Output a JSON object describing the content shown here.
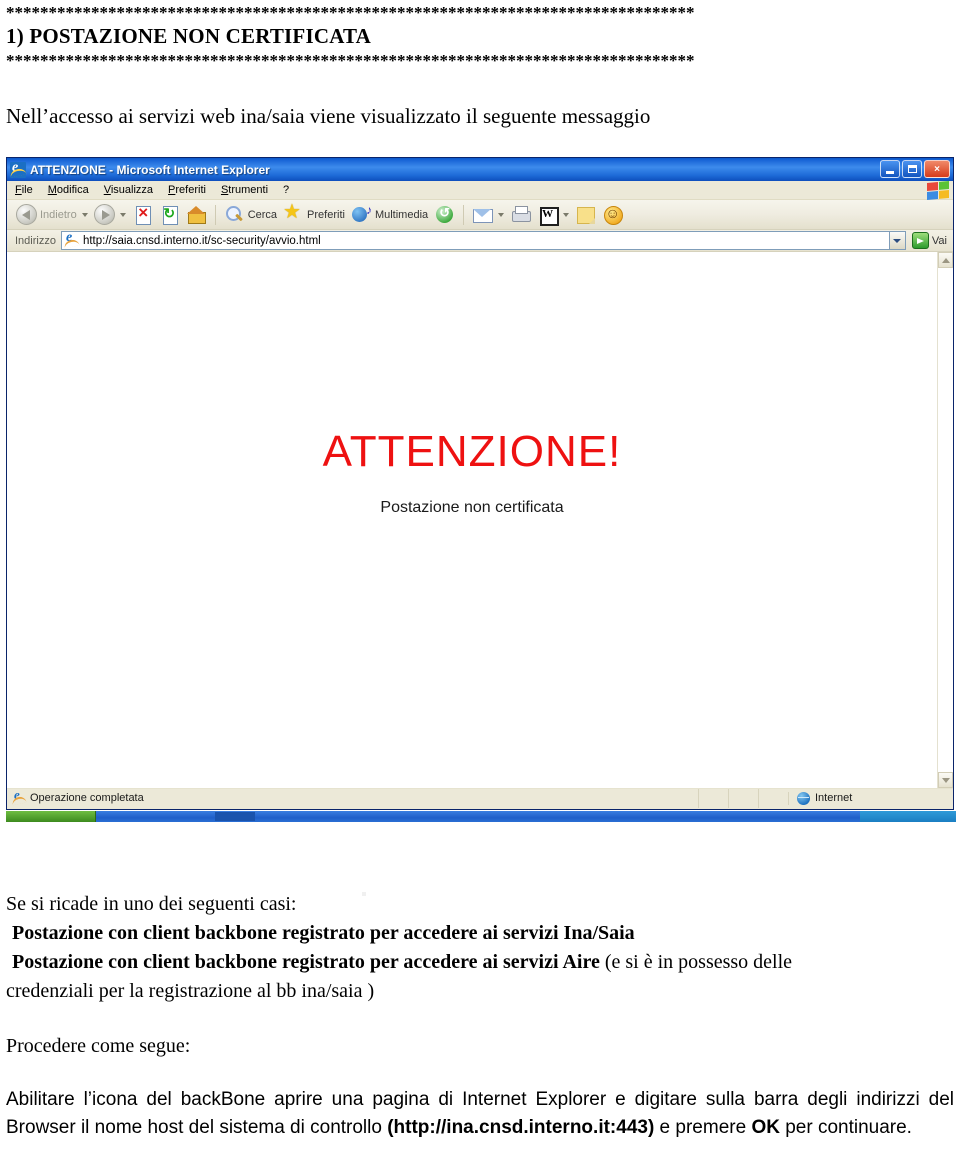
{
  "document": {
    "stars_top": "*********************************************************************************",
    "heading": "1) POSTAZIONE NON CERTIFICATA",
    "stars_bottom": "*********************************************************************************",
    "intro": "Nell’accesso ai servizi web ina/saia viene visualizzato il seguente messaggio",
    "cases_intro": "Se si ricade in uno dei seguenti casi:",
    "case_1": "Postazione con client backbone registrato per accedere ai servizi Ina/Saia",
    "case_2_bold": "Postazione con client backbone registrato per accedere ai servizi Aire",
    "case_2_rest": "(e si è in possesso delle",
    "case_2_cont": "credenziali per la registrazione al bb ina/saia )",
    "procedere": "Procedere come segue:",
    "final_part1": "Abilitare l’icona del backBone aprire una pagina di Internet Explorer e digitare sulla barra degli indirizzi del Browser il nome host del sistema di controllo ",
    "final_url": "(http://ina.cnsd.interno.it:443)",
    "final_part2": " e premere ",
    "final_ok": "OK",
    "final_part3": " per continuare."
  },
  "browser": {
    "titlebar": {
      "title": "ATTENZIONE - Microsoft Internet Explorer",
      "icon": "ie-logo-icon",
      "minimize_label": "",
      "restore_label": "",
      "close_label": "×"
    },
    "menu": [
      {
        "label": "File",
        "accel": "F"
      },
      {
        "label": "Modifica",
        "accel": "M"
      },
      {
        "label": "Visualizza",
        "accel": "V"
      },
      {
        "label": "Preferiti",
        "accel": "P"
      },
      {
        "label": "Strumenti",
        "accel": "S"
      },
      {
        "label": "?",
        "accel": ""
      }
    ],
    "toolbar": {
      "back_label": "Indietro",
      "forward_label": "",
      "stop_label": "",
      "refresh_label": "",
      "home_label": "",
      "search_label": "Cerca",
      "favorites_label": "Preferiti",
      "multimedia_label": "Multimedia",
      "history_label": "",
      "mail_label": "",
      "print_label": "",
      "edit_label": "",
      "note_label": "",
      "smiley_label": ""
    },
    "address": {
      "label": "Indirizzo",
      "url": "http://saia.cnsd.interno.it/sc-security/avvio.html",
      "go_label": "Vai"
    },
    "page": {
      "title": "ATTENZIONE!",
      "subtitle": "Postazione non certificata",
      "title_color": "#ee1111"
    },
    "statusbar": {
      "message": "Operazione completata",
      "zone": "Internet"
    }
  }
}
